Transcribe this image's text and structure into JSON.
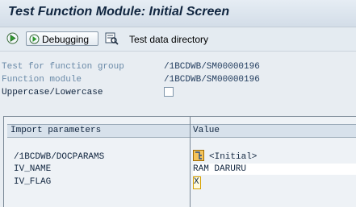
{
  "title": "Test Function Module: Initial Screen",
  "toolbar": {
    "debugging_label": "Debugging",
    "test_data_label": "Test data directory",
    "icons": [
      "execute-icon",
      "debug-icon",
      "test-data-directory-icon"
    ]
  },
  "fields": [
    {
      "label": "Test for function group",
      "value": "/1BCDWB/SM00000196"
    },
    {
      "label": "Function module",
      "value": "/1BCDWB/SM00000196"
    },
    {
      "label": "Uppercase/Lowercase",
      "checked": false
    }
  ],
  "params_table": {
    "headers": [
      "Import parameters",
      "Value"
    ],
    "rows": [
      {
        "name": "/1BCDWB/DOCPARAMS",
        "value": "<Initial>"
      },
      {
        "name": "IV_NAME",
        "value": "RAM DARURU"
      },
      {
        "name": "IV_FLAG",
        "value": "X"
      }
    ]
  },
  "colors": {
    "title_text": "#10253f",
    "field_label": "#6a8aa8",
    "field_value": "#1f3a5c",
    "header_bg": "#d7e1eb"
  }
}
